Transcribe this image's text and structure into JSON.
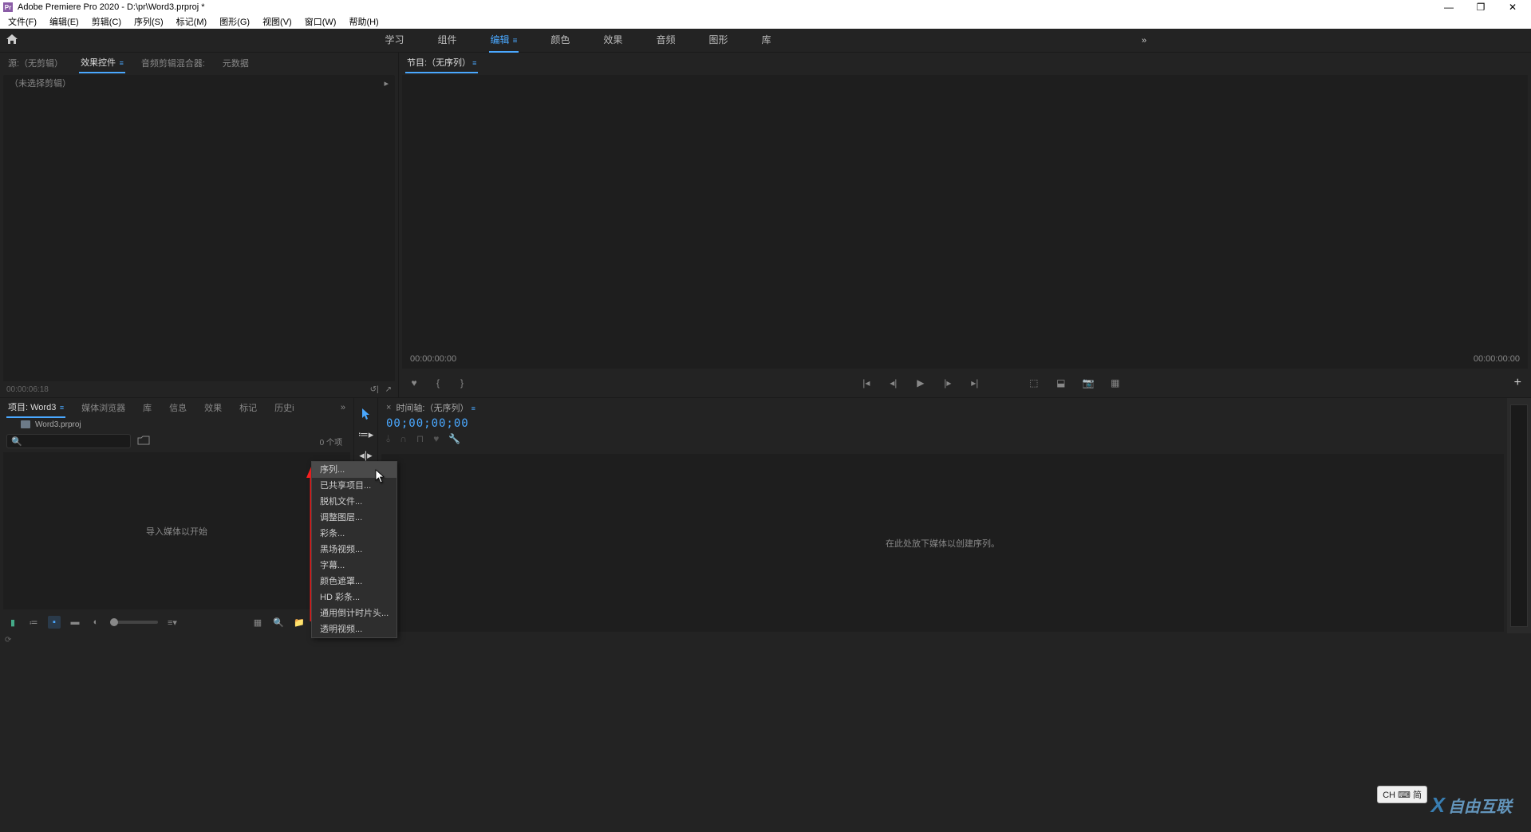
{
  "titlebar": {
    "app_icon": "Pr",
    "title": "Adobe Premiere Pro 2020 - D:\\pr\\Word3.prproj *"
  },
  "menubar": {
    "items": [
      "文件(F)",
      "编辑(E)",
      "剪辑(C)",
      "序列(S)",
      "标记(M)",
      "图形(G)",
      "视图(V)",
      "窗口(W)",
      "帮助(H)"
    ]
  },
  "workspaces": {
    "tabs": [
      "学习",
      "组件",
      "编辑",
      "颜色",
      "效果",
      "音频",
      "图形",
      "库"
    ],
    "active_index": 2,
    "overflow": "»"
  },
  "source_panel": {
    "tabs": [
      "源:（无剪辑）",
      "效果控件",
      "音频剪辑混合器:",
      "元数据"
    ],
    "active_tab_index": 1,
    "body_header": "（未选择剪辑）",
    "footer_time": "00:00:06:18"
  },
  "program_panel": {
    "title": "节目:（无序列）",
    "time_left": "00:00:00:00",
    "time_right": "00:00:00:00"
  },
  "project_panel": {
    "tabs": [
      "项目: Word3",
      "媒体浏览器",
      "库",
      "信息",
      "效果",
      "标记",
      "历史i"
    ],
    "active_tab_index": 0,
    "overflow": "»",
    "file_name": "Word3.prproj",
    "search_placeholder": "",
    "item_count": "0 个项",
    "empty_text": "导入媒体以开始"
  },
  "timeline_panel": {
    "title": "时间轴:（无序列）",
    "time": "00;00;00;00",
    "empty_text": "在此处放下媒体以创建序列。"
  },
  "context_menu": {
    "items": [
      "序列...",
      "已共享项目...",
      "脱机文件...",
      "调整图层...",
      "彩条...",
      "黑场视频...",
      "字幕...",
      "颜色遮罩...",
      "HD 彩条...",
      "通用倒计时片头...",
      "透明视频..."
    ],
    "hover_index": 0
  },
  "ime": {
    "label": "CH ⌨ 简"
  },
  "watermark": {
    "text": "自由互联"
  },
  "icons": {
    "home": "⌂",
    "search": "🔍",
    "indicator": "≡"
  }
}
